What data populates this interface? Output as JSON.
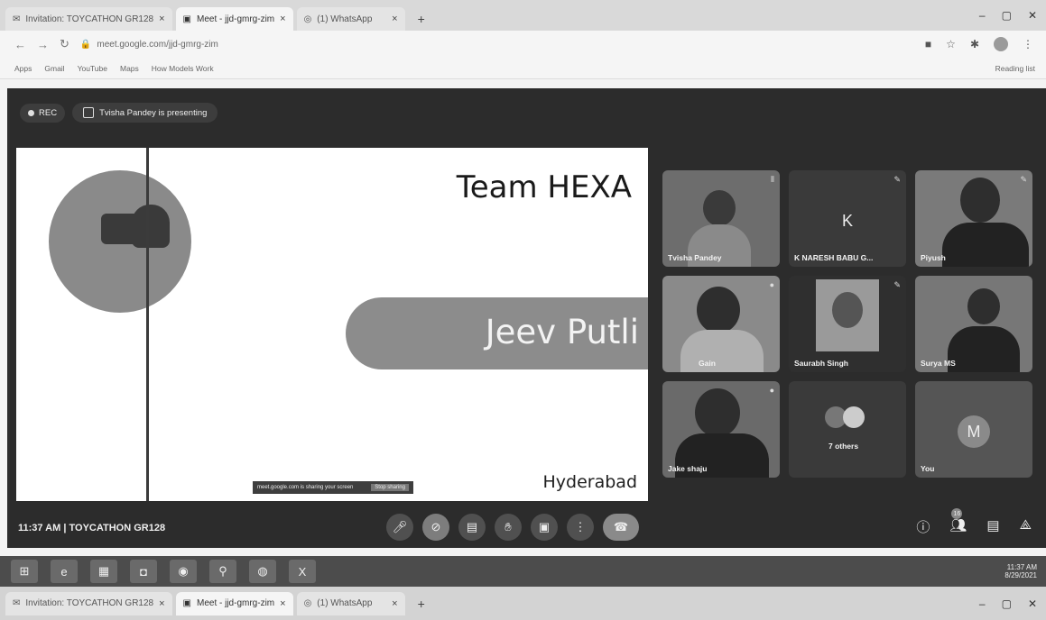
{
  "browser": {
    "tabs": [
      {
        "title": "Invitation: TOYCATHON GR128",
        "active": false
      },
      {
        "title": "Meet - jjd-gmrg-zim",
        "active": true
      },
      {
        "title": "(1) WhatsApp",
        "active": false
      }
    ],
    "url": "meet.google.com/jjd-gmrg-zim",
    "bookmarks": [
      "Apps",
      "Gmail",
      "YouTube",
      "Maps",
      "How Models Work"
    ],
    "reading_list": "Reading list"
  },
  "meet": {
    "rec_label": "REC",
    "presenting_label": "Tvisha Pandey is presenting",
    "slide": {
      "title": "Team HEXA",
      "project": "Jeev Putli",
      "city": "Hyderabad",
      "toast_text": "meet.google.com is sharing your screen",
      "toast_action": "Stop sharing"
    },
    "participants": [
      {
        "name": "Tvisha Pandey",
        "type": "camera",
        "letter": ""
      },
      {
        "name": "K NARESH BABU G...",
        "type": "avatar",
        "letter": "K"
      },
      {
        "name": "Piyush",
        "type": "camera",
        "letter": ""
      },
      {
        "name": "Gain",
        "type": "camera",
        "letter": ""
      },
      {
        "name": "Saurabh Singh",
        "type": "camera",
        "letter": ""
      },
      {
        "name": "Surya MS",
        "type": "camera",
        "letter": ""
      },
      {
        "name": "Jake shaju",
        "type": "camera",
        "letter": ""
      },
      {
        "name": "7 others",
        "type": "group",
        "letter": ""
      },
      {
        "name": "You",
        "type": "avatar",
        "letter": "M"
      }
    ],
    "meeting_time": "11:37 AM",
    "meeting_code": "TOYCATHON GR128",
    "people_count": "16"
  },
  "taskbar": {
    "time": "11:37 AM",
    "date": "8/29/2021"
  }
}
